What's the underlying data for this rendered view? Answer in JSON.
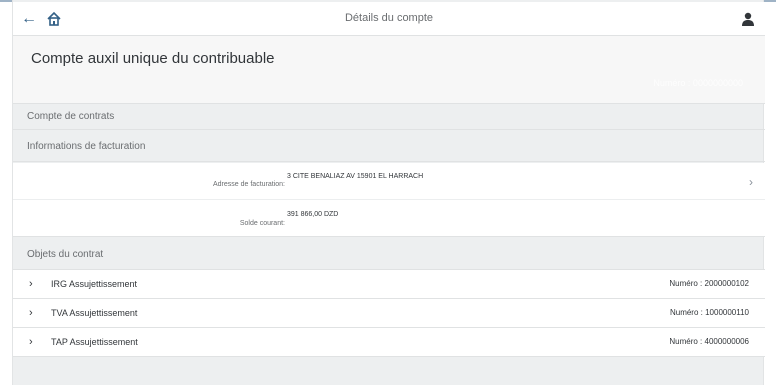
{
  "shell": {
    "title": "Détails du compte",
    "back_icon": "←"
  },
  "header": {
    "title": "Compte auxil unique du contribuable",
    "attribute": "Numéro : 0000000000"
  },
  "sections": {
    "contract_accounts": "Compte de contrats",
    "billing_info": "Informations de facturation",
    "contract_objects": "Objets du contrat"
  },
  "billing": {
    "address_label": "Adresse de facturation:",
    "address_value": "3 CITE BENALIAZ AV 15901 EL HARRACH",
    "balance_label": "Solde courant:",
    "balance_value": "391 866,00 DZD"
  },
  "contract_objects": [
    {
      "label": "IRG Assujettissement",
      "number": "Numéro : 2000000102"
    },
    {
      "label": "TVA Assujettissement",
      "number": "Numéro : 1000000110"
    },
    {
      "label": "TAP Assujettissement",
      "number": "Numéro : 4000000006"
    }
  ],
  "icons": {
    "back": "arrow-left-icon",
    "home": "home-icon",
    "user": "user-icon",
    "expand": "chevron-right-icon"
  }
}
